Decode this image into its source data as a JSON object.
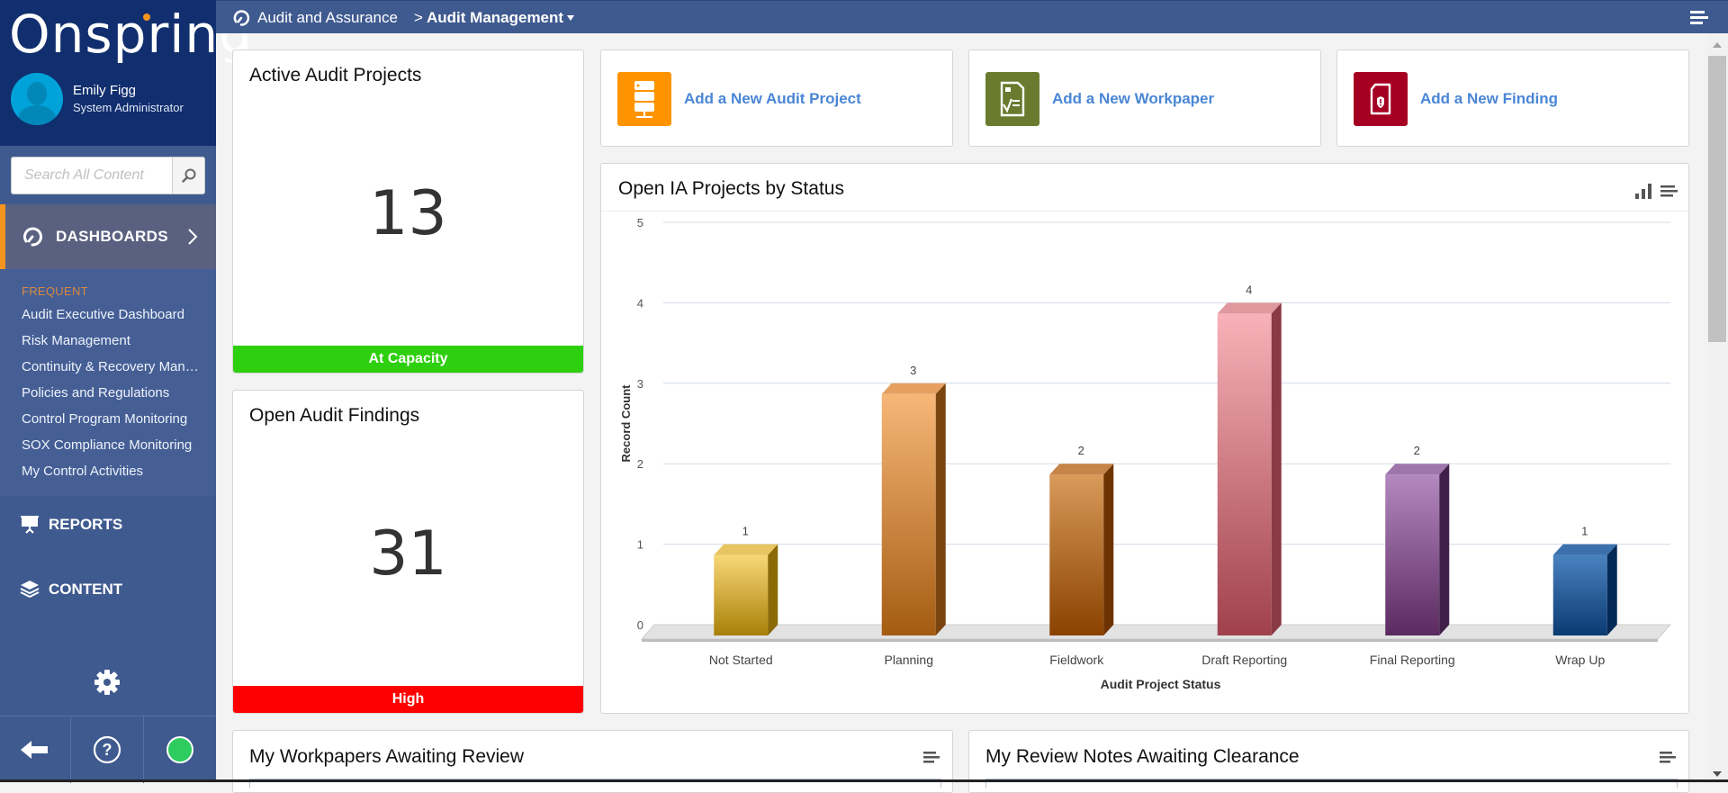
{
  "app": {
    "logo": "Onspring"
  },
  "user": {
    "name": "Emily Figg",
    "role": "System Administrator"
  },
  "search": {
    "placeholder": "Search All Content",
    "value": ""
  },
  "sidebar": {
    "dashboards_label": "DASHBOARDS",
    "frequent_title": "FREQUENT",
    "frequent_items": [
      {
        "label": "Audit Executive Dashboard"
      },
      {
        "label": "Risk Management"
      },
      {
        "label": "Continuity & Recovery Manag..."
      },
      {
        "label": "Policies and Regulations"
      },
      {
        "label": "Control Program Monitoring"
      },
      {
        "label": "SOX Compliance Monitoring"
      },
      {
        "label": "My Control Activities"
      }
    ],
    "reports_label": "REPORTS",
    "content_label": "CONTENT",
    "status_color": "#2ecc5e"
  },
  "breadcrumb": {
    "parent": "Audit and Assurance",
    "separator": ">",
    "current": "Audit Management"
  },
  "kpis": [
    {
      "title": "Active Audit Projects",
      "value": "13",
      "status": "At Capacity",
      "status_color": "#2dcf0e"
    },
    {
      "title": "Open Audit Findings",
      "value": "31",
      "status": "High",
      "status_color": "#ff0000"
    }
  ],
  "actions": [
    {
      "label": "Add a New Audit Project",
      "icon": "server-icon",
      "color": "#ff9400"
    },
    {
      "label": "Add a New Workpaper",
      "icon": "workpaper-icon",
      "color": "#6a7a2f"
    },
    {
      "label": "Add a New Finding",
      "icon": "finding-shield-icon",
      "color": "#a50021"
    }
  ],
  "chart_data": {
    "type": "bar",
    "title": "Open IA Projects by Status",
    "xlabel": "Audit Project Status",
    "ylabel": "Record Count",
    "categories": [
      "Not Started",
      "Planning",
      "Fieldwork",
      "Draft Reporting",
      "Final Reporting",
      "Wrap Up"
    ],
    "values": [
      1,
      3,
      2,
      4,
      2,
      1
    ],
    "colors": [
      {
        "front_top": "#f8d777",
        "front_bottom": "#a88008",
        "side": "#8a6a05",
        "top": "#e8c560"
      },
      {
        "front_top": "#f7b778",
        "front_bottom": "#a45c12",
        "side": "#7a4510",
        "top": "#e5a062"
      },
      {
        "front_top": "#d99a5a",
        "front_bottom": "#8a4200",
        "side": "#6c3300",
        "top": "#c78448"
      },
      {
        "front_top": "#f8b2b8",
        "front_bottom": "#a0414d",
        "side": "#8a3a45",
        "top": "#e0989f"
      },
      {
        "front_top": "#b489c0",
        "front_bottom": "#5a2a60",
        "side": "#40204a",
        "top": "#9f76ab"
      },
      {
        "front_top": "#4a82c0",
        "front_bottom": "#0b3a72",
        "side": "#062a57",
        "top": "#3c70ad"
      }
    ],
    "yticks": [
      0,
      1,
      2,
      3,
      4,
      5
    ],
    "ylim": [
      0,
      5
    ],
    "grid": true,
    "data_labels": true,
    "legend": "none"
  },
  "widgets": [
    {
      "title": "My Workpapers Awaiting Review"
    },
    {
      "title": "My Review Notes Awaiting Clearance"
    }
  ]
}
